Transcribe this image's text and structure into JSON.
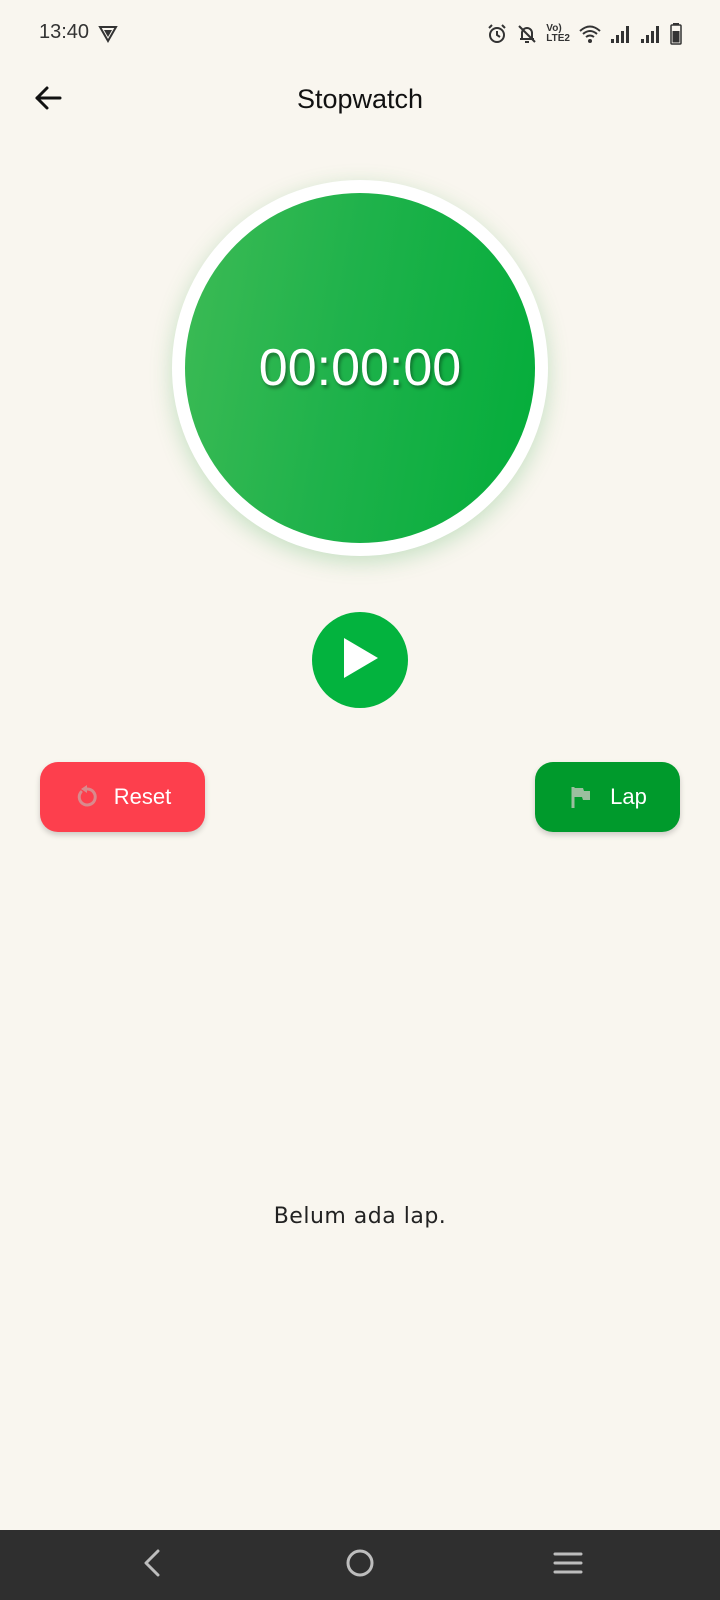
{
  "status_bar": {
    "time": "13:40",
    "icons": [
      "vpn-icon",
      "alarm-icon",
      "notifications-off-icon",
      "volte-icon",
      "wifi-icon",
      "signal-icon",
      "signal-icon",
      "battery-icon"
    ],
    "volte_line1": "Vo)",
    "volte_line2": "LTE2"
  },
  "app_bar": {
    "title": "Stopwatch",
    "back_icon": "arrow-left-icon"
  },
  "timer": {
    "display": "00:00:00"
  },
  "controls": {
    "play_icon": "play-icon",
    "reset_label": "Reset",
    "reset_icon": "restart-icon",
    "lap_label": "Lap",
    "lap_icon": "flag-icon"
  },
  "laps": {
    "items": [],
    "empty_message": "Belum ada lap."
  },
  "nav_bar": {
    "icons": [
      "nav-back-icon",
      "nav-home-icon",
      "nav-recents-icon"
    ]
  },
  "colors": {
    "background": "#f9f6ef",
    "timer_green": "#1fb24b",
    "play_green": "#03b33e",
    "reset_red": "#fd3f4d",
    "lap_green": "#009a2c",
    "nav_bar": "#2f2f2f"
  }
}
